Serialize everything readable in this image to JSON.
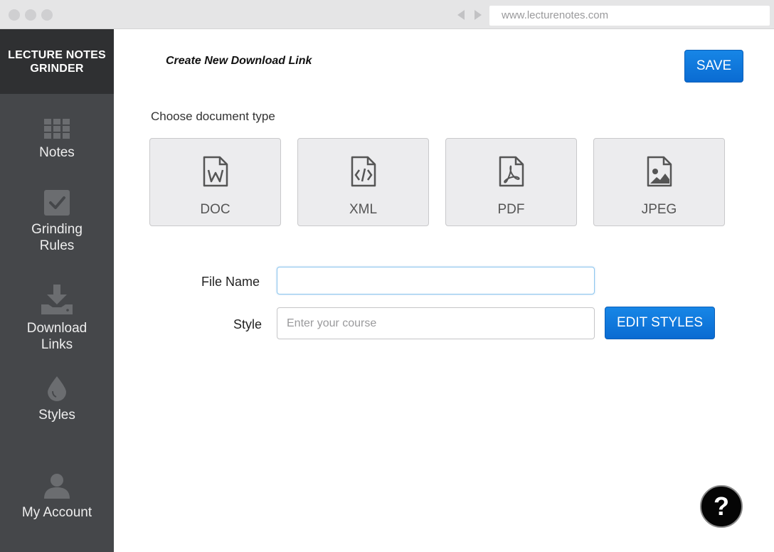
{
  "browser": {
    "url": "www.lecturenotes.com",
    "dot_color": "#cfcfd1"
  },
  "sidebar": {
    "brand_line1": "LECTURE NOTES",
    "brand_line2": "GRINDER",
    "items": [
      {
        "icon": "grid-icon",
        "line1": "Notes",
        "line2": ""
      },
      {
        "icon": "checkbox-icon",
        "line1": "Grinding",
        "line2": "Rules"
      },
      {
        "icon": "download-icon",
        "line1": "Download",
        "line2": "Links"
      },
      {
        "icon": "drop-icon",
        "line1": "Styles",
        "line2": ""
      },
      {
        "icon": "user-icon",
        "line1": "My Account",
        "line2": ""
      }
    ]
  },
  "main": {
    "title": "Create New Download Link",
    "save_label": "SAVE",
    "section_label": "Choose document type",
    "doc_types": [
      {
        "icon": "doc-file-icon",
        "label": "DOC"
      },
      {
        "icon": "xml-file-icon",
        "label": "XML"
      },
      {
        "icon": "pdf-file-icon",
        "label": "PDF"
      },
      {
        "icon": "image-file-icon",
        "label": "JPEG"
      }
    ],
    "file_name": {
      "label": "File Name",
      "value": "",
      "placeholder": ""
    },
    "style": {
      "label": "Style",
      "value": "",
      "placeholder": "Enter your course"
    },
    "edit_styles_label": "EDIT STYLES",
    "help_label": "?"
  },
  "colors": {
    "accent": "#0a6bd2",
    "sidebar_bg": "#45474a",
    "brand_bg": "#2f3032"
  }
}
